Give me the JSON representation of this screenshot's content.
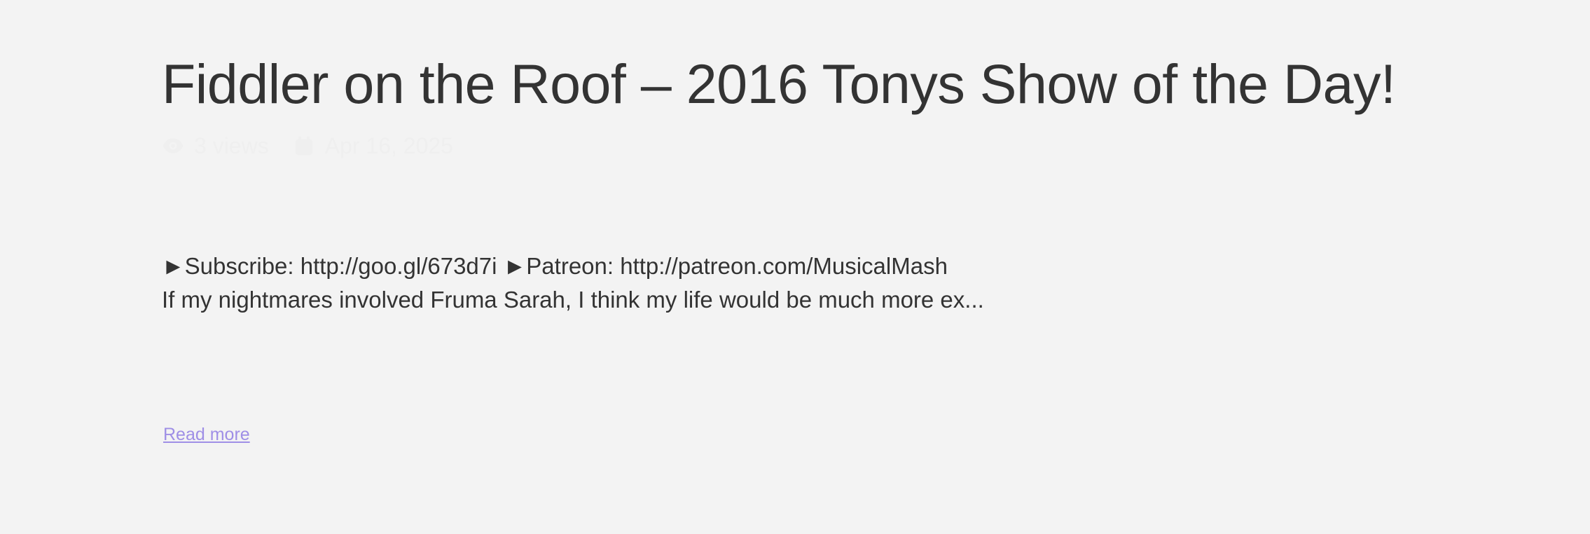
{
  "post": {
    "title": "Fiddler on the Roof – 2016 Tonys Show of the Day!",
    "meta": {
      "views_icon": "eye-icon",
      "views": "3 views",
      "date_icon": "calendar-icon",
      "date": "Apr 16, 2025"
    },
    "excerpt": {
      "line1": "►Subscribe: http://goo.gl/673d7i ►Patreon: http://patreon.com/MusicalMash",
      "line2": "If my nightmares involved Fruma Sarah, I think my life would be much more ex..."
    },
    "read_more_label": "Read more"
  },
  "colors": {
    "background": "#f3f3f3",
    "text": "#333333",
    "meta_text": "#efefef",
    "link": "#9f8fe6"
  }
}
